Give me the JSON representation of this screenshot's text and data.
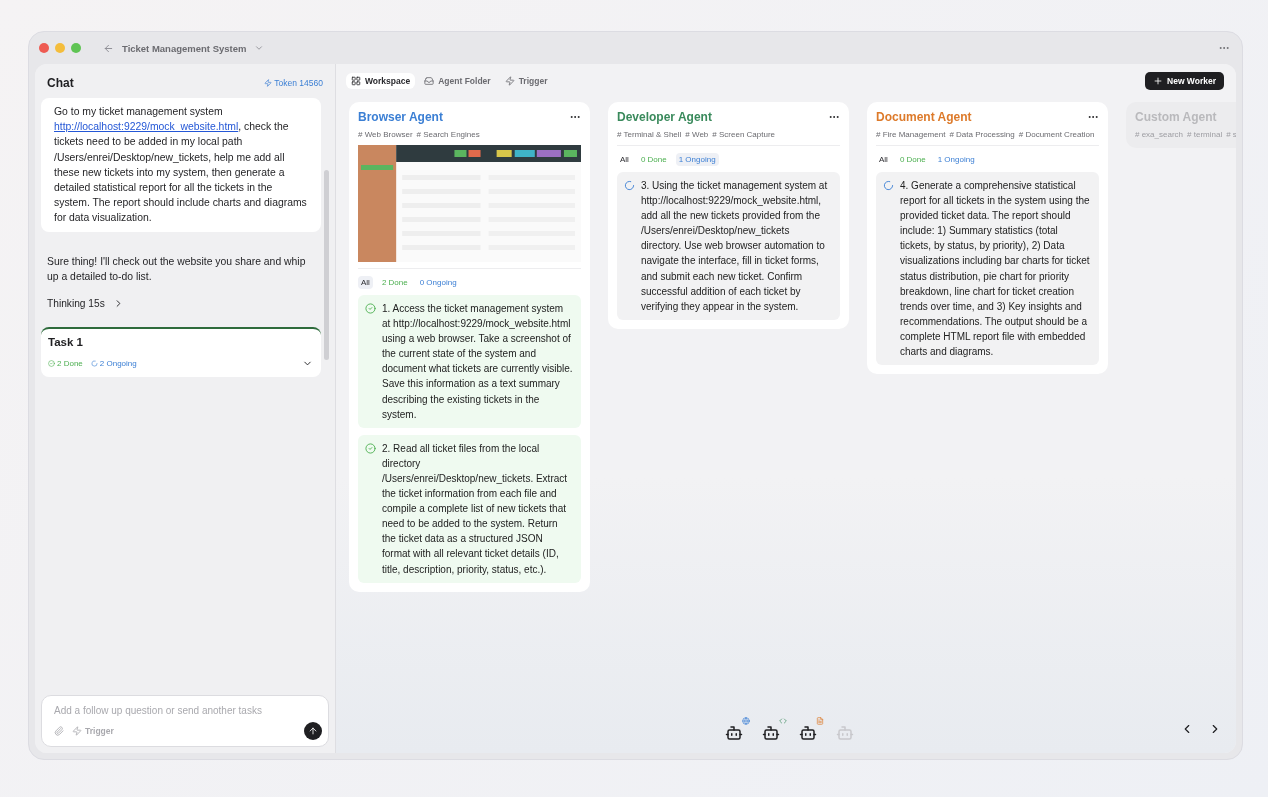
{
  "window": {
    "title": "Ticket Management System"
  },
  "chat": {
    "title": "Chat",
    "token": "Token 14560",
    "messages": [
      {
        "kind": "user",
        "before": "Go to my ticket management system ",
        "link": "http://localhost:9229/mock_website.html",
        "after": ", check the tickets need to be added in my local path /Users/enrei/Desktop/new_tickets, help me add all these new tickets into my system, then generate a detailed statistical report for all the tickets in the system. The report should include charts and diagrams for data visualization."
      },
      {
        "kind": "assistant",
        "text": "Sure thing! I'll check out the website you share and whip up a detailed to-do list."
      }
    ],
    "thinking": "Thinking 15s",
    "task": {
      "title": "Task 1",
      "done": "2 Done",
      "ongoing": "2 Ongoing",
      "expanded": false
    },
    "input": {
      "placeholder": "Add a follow up question or send another tasks",
      "trigger": "Trigger"
    }
  },
  "workspace": {
    "tabs": [
      {
        "label": "Workspace",
        "selected": true
      },
      {
        "label": "Agent Folder",
        "selected": false
      },
      {
        "label": "Trigger",
        "selected": false
      }
    ],
    "new_worker": "New Worker",
    "agents": [
      {
        "name": "Browser Agent",
        "color": "#3b7fd4",
        "disabled": false,
        "tags": [
          "# Web Browser",
          "# Search Engines"
        ],
        "screenshot": {
          "kind": "picture"
        },
        "filters": [
          {
            "kind": "all",
            "label": "All",
            "selected": true
          },
          {
            "kind": "done",
            "label": "2 Done",
            "selected": false
          },
          {
            "kind": "ongoing",
            "label": "0 Ongoing",
            "selected": false
          }
        ],
        "tasks": [
          {
            "done": true,
            "text": "1. Access the ticket management system at http://localhost:9229/mock_website.html using a web browser. Take a screenshot of the current state of the system and document what tickets are currently visible. Save this information as a text summary describing the existing tickets in the system."
          },
          {
            "done": true,
            "text": "2. Read all ticket files from the local directory /Users/enrei/Desktop/new_tickets. Extract the ticket information from each file and compile a complete list of new tickets that need to be added to the system. Return the ticket data as a structured JSON format with all relevant ticket details (ID, title, description, priority, status, etc.)."
          }
        ]
      },
      {
        "name": "Developer Agent",
        "color": "#3a8a5c",
        "disabled": false,
        "tags": [
          "# Terminal & Shell",
          "# Web",
          "# Screen Capture"
        ],
        "filters": [
          {
            "kind": "all",
            "label": "All",
            "selected": false
          },
          {
            "kind": "done",
            "label": "0 Done",
            "selected": false
          },
          {
            "kind": "ongoing",
            "label": "1 Ongoing",
            "selected": true
          }
        ],
        "tasks": [
          {
            "done": false,
            "text": "3. Using the ticket management system at http://localhost:9229/mock_website.html, add all the new tickets provided from the /Users/enrei/Desktop/new_tickets directory. Use web browser automation to navigate the interface, fill in ticket forms, and submit each new ticket. Confirm successful addition of each ticket by verifying they appear in the system."
          }
        ]
      },
      {
        "name": "Document Agent",
        "color": "#dd7a2a",
        "disabled": false,
        "tags": [
          "# Fire Management",
          "# Data Processing",
          "# Document Creation"
        ],
        "filters": [
          {
            "kind": "all",
            "label": "All",
            "selected": false
          },
          {
            "kind": "done",
            "label": "0 Done",
            "selected": false
          },
          {
            "kind": "ongoing",
            "label": "1 Ongoing",
            "selected": false
          }
        ],
        "tasks": [
          {
            "done": false,
            "text": "4. Generate a comprehensive statistical report for all tickets in the system using the provided ticket data. The report should include: 1) Summary statistics (total tickets, by status, by priority), 2) Data visualizations including bar charts for ticket status distribution, pie chart for priority breakdown, line chart for ticket creation trends over time, and 3) Key insights and recommendations. The output should be a complete HTML report file with embedded charts and diagrams."
          }
        ]
      },
      {
        "name": "Custom Agent",
        "color": "#b9b9bc",
        "disabled": true,
        "tags": [
          "# exa_search",
          "# terminal",
          "# s"
        ]
      }
    ],
    "dock": [
      {
        "kind": "globe",
        "disabled": false
      },
      {
        "kind": "code",
        "disabled": false
      },
      {
        "kind": "document",
        "disabled": false
      },
      {
        "kind": "none",
        "disabled": true
      }
    ]
  }
}
